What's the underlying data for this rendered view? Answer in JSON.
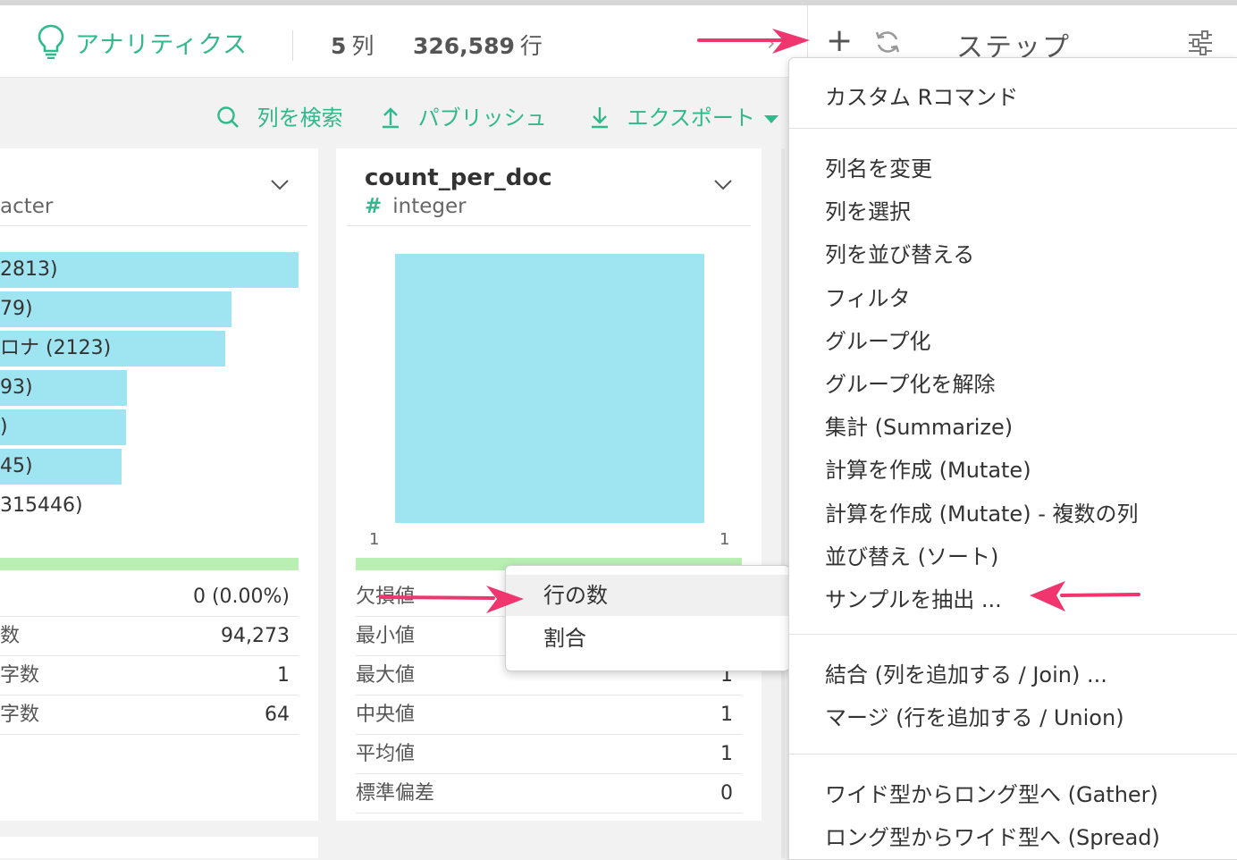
{
  "header": {
    "app_label": "アナリティクス",
    "columns_count": "5",
    "columns_unit": "列",
    "rows_count": "326,589",
    "rows_unit": "行",
    "collapse_glyph": "›"
  },
  "steps": {
    "add_glyph": "+",
    "title": "ステップ"
  },
  "toolbar": {
    "search": "列を検索",
    "publish": "パブリッシュ",
    "export": "エクスポート"
  },
  "left_column": {
    "type_partial": "acter",
    "bars": [
      {
        "label": "2813)",
        "value": 2813
      },
      {
        "label": "79)",
        "value": 2179
      },
      {
        "label": "ロナ (2123)",
        "value": 2123
      },
      {
        "label": "93)",
        "value": 1193
      },
      {
        "label": ")",
        "value": 1190
      },
      {
        "label": "45)",
        "value": 1145
      }
    ],
    "other_label": "315446)",
    "stats": [
      {
        "label": "",
        "value": "0 (0.00%)"
      },
      {
        "label": "数",
        "value": "94,273"
      },
      {
        "label": "字数",
        "value": "1"
      },
      {
        "label": "字数",
        "value": "64"
      }
    ]
  },
  "mid_column": {
    "name": "count_per_doc",
    "type_symbol": "#",
    "type": "integer",
    "axis_min": "1",
    "axis_max": "1",
    "stats": [
      {
        "label": "欠損値",
        "value": ""
      },
      {
        "label": "最小値",
        "value": ""
      },
      {
        "label": "最大値",
        "value": "1"
      },
      {
        "label": "中央値",
        "value": "1"
      },
      {
        "label": "平均値",
        "value": "1"
      },
      {
        "label": "標準偏差",
        "value": "0"
      }
    ]
  },
  "popup": {
    "items": [
      "行の数",
      "割合"
    ]
  },
  "menu": {
    "custom_r": "カスタム Rコマンド",
    "group1": [
      "列名を変更",
      "列を選択",
      "列を並び替える",
      "フィルタ",
      "グループ化",
      "グループ化を解除",
      "集計 (Summarize)",
      "計算を作成 (Mutate)",
      "計算を作成 (Mutate) - 複数の列",
      "並び替え (ソート)",
      "サンプルを抽出 ..."
    ],
    "group2": [
      "結合 (列を追加する / Join) ...",
      "マージ (行を追加する / Union)"
    ],
    "group3": [
      "ワイド型からロング型へ (Gather)",
      "ロング型からワイド型へ (Spread)"
    ]
  },
  "colors": {
    "accent": "#2fb98c",
    "bar": "#9ee4f1",
    "complete_bar": "#b9efb3",
    "annotation_arrow": "#f0356f"
  }
}
